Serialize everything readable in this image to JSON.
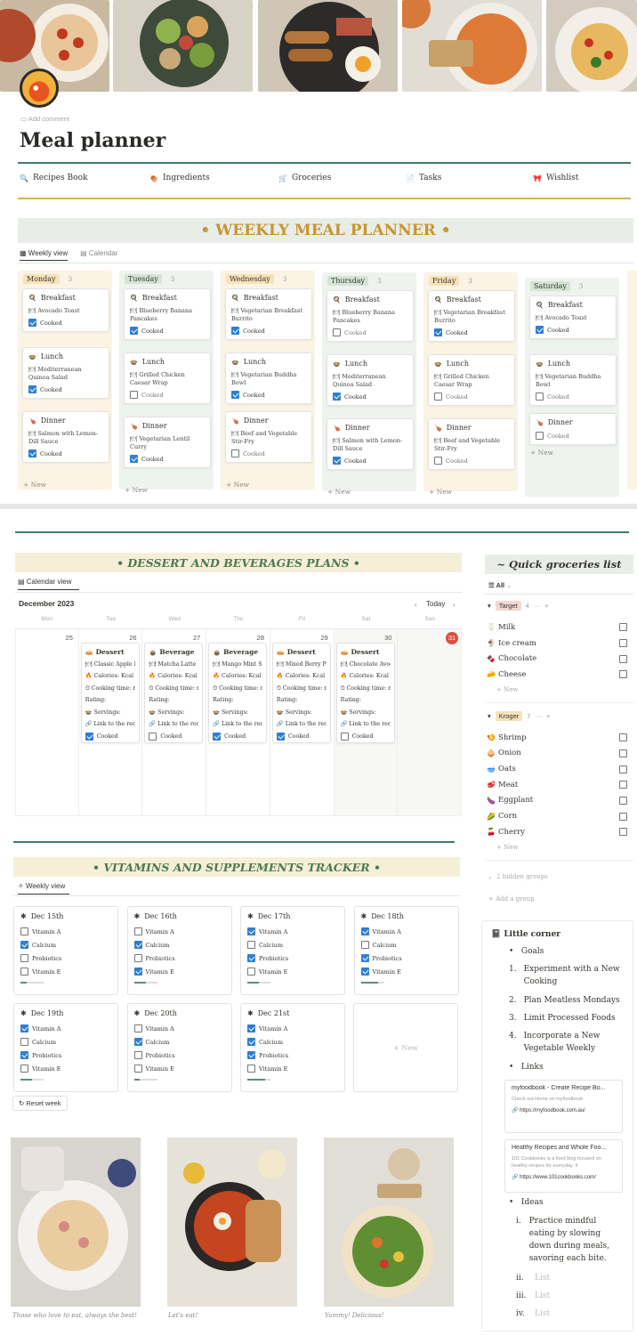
{
  "page": {
    "add_comment": "Add comment",
    "title": "Meal planner"
  },
  "nav": [
    "Recipes Book",
    "Ingredients",
    "Groceries",
    "Tasks",
    "Wishlist"
  ],
  "weekly": {
    "header": "• WEEKLY MEAL PLANNER •",
    "views": [
      "Weekly view",
      "Calendar"
    ],
    "new_label": "+ New",
    "cooked_label": "Cooked",
    "columns": [
      {
        "day": "Monday",
        "count": "3",
        "color": "#fbf3e4",
        "tag": "#f7e2b9",
        "meals": [
          {
            "meal": "Breakfast",
            "dish": "Avocado Toast",
            "cooked": true
          },
          {
            "meal": "Lunch",
            "dish": "Mediterranean Quinoa Salad",
            "cooked": true
          },
          {
            "meal": "Dinner",
            "dish": "Salmon with Lemon-Dill Sauce",
            "cooked": true
          }
        ]
      },
      {
        "day": "Tuesday",
        "count": "3",
        "color": "#eef3ee",
        "tag": "#d3e6d5",
        "meals": [
          {
            "meal": "Breakfast",
            "dish": "Blueberry Banana Pancakes",
            "cooked": true
          },
          {
            "meal": "Lunch",
            "dish": "Grilled Chicken Caesar Wrap",
            "cooked": false
          },
          {
            "meal": "Dinner",
            "dish": "Vegetarian Lentil Curry",
            "cooked": true
          }
        ]
      },
      {
        "day": "Wednesday",
        "count": "3",
        "color": "#fbf3e4",
        "tag": "#f7e2b9",
        "meals": [
          {
            "meal": "Breakfast",
            "dish": "Vegetarian Breakfast Burrito",
            "cooked": true
          },
          {
            "meal": "Lunch",
            "dish": "Vegetarian Buddha Bowl",
            "cooked": true
          },
          {
            "meal": "Dinner",
            "dish": "Beef and Vegetable Stir-Fry",
            "cooked": false
          }
        ]
      },
      {
        "day": "Thursday",
        "count": "3",
        "color": "#eef3ee",
        "tag": "#d3e6d5",
        "meals": [
          {
            "meal": "Breakfast",
            "dish": "Blueberry Banana Pancakes",
            "cooked": false
          },
          {
            "meal": "Lunch",
            "dish": "Mediterranean Quinoa Salad",
            "cooked": true
          },
          {
            "meal": "Dinner",
            "dish": "Salmon with Lemon-Dill Sauce",
            "cooked": true
          }
        ]
      },
      {
        "day": "Friday",
        "count": "3",
        "color": "#fbf3e4",
        "tag": "#f7e2b9",
        "meals": [
          {
            "meal": "Breakfast",
            "dish": "Vegetarian Breakfast Burrito",
            "cooked": true
          },
          {
            "meal": "Lunch",
            "dish": "Grilled Chicken Caesar Wrap",
            "cooked": false
          },
          {
            "meal": "Dinner",
            "dish": "Beef and Vegetable Stir-Fry",
            "cooked": false
          }
        ]
      },
      {
        "day": "Saturday",
        "count": "3",
        "color": "#eef3ee",
        "tag": "#d3e6d5",
        "meals": [
          {
            "meal": "Breakfast",
            "dish": "Avocado Toast",
            "cooked": true
          },
          {
            "meal": "Lunch",
            "dish": "Vegetarian Buddha Bowl",
            "cooked": false
          },
          {
            "meal": "Dinner",
            "dish": "",
            "cooked": false
          }
        ]
      }
    ]
  },
  "dessert": {
    "header": "• DESSERT AND BEVERAGES PLANS •",
    "view": "Calendar view",
    "month": "December 2023",
    "today": "Today",
    "weekdays": [
      "Mon",
      "Tue",
      "Wed",
      "Thu",
      "Fri",
      "Sat",
      "Sun"
    ],
    "dates": [
      "25",
      "26",
      "27",
      "28",
      "29",
      "30",
      "31"
    ],
    "cards": [
      {
        "type": "Dessert",
        "name": "Classic Apple Pie",
        "cooked": true
      },
      {
        "type": "Beverage",
        "name": "Matcha Latte",
        "cooked": false
      },
      {
        "type": "Beverage",
        "name": "Mango Mint Smo",
        "cooked": true
      },
      {
        "type": "Dessert",
        "name": "Mixed Berry Parf",
        "cooked": true
      },
      {
        "type": "Dessert",
        "name": "Chocolate Avoca",
        "cooked": false
      }
    ],
    "fields": {
      "calories": "Calories: Kcal",
      "cooking": "Cooking time: m",
      "rating": "Rating:",
      "servings": "Servings:",
      "link": "Link to the recip",
      "cooked": "Cooked"
    }
  },
  "vitamins": {
    "header": "• VITAMINS AND SUPPLEMENTS TRACKER •",
    "view": "Weekly view",
    "items": [
      "Vitamin A",
      "Calcium",
      "Probiotics",
      "Vitamin E"
    ],
    "days": [
      {
        "date": "Dec 15th",
        "checks": [
          false,
          true,
          false,
          false
        ],
        "progress": 0.25
      },
      {
        "date": "Dec 16th",
        "checks": [
          false,
          true,
          false,
          true
        ],
        "progress": 0.5
      },
      {
        "date": "Dec 17th",
        "checks": [
          true,
          false,
          true,
          false
        ],
        "progress": 0.5
      },
      {
        "date": "Dec 18th",
        "checks": [
          true,
          false,
          true,
          true
        ],
        "progress": 0.75
      },
      {
        "date": "Dec 19th",
        "checks": [
          true,
          false,
          true,
          false
        ],
        "progress": 0.5
      },
      {
        "date": "Dec 20th",
        "checks": [
          false,
          true,
          false,
          false
        ],
        "progress": 0.25
      },
      {
        "date": "Dec 21st",
        "checks": [
          true,
          true,
          true,
          false
        ],
        "progress": 0.75
      }
    ],
    "new_label": "+ New",
    "reset": "Reset week"
  },
  "groceries": {
    "header": "~ Quick groceries list",
    "filter": "All",
    "groups": [
      {
        "name": "Target",
        "count": "4",
        "items": [
          {
            "n": "Milk",
            "e": "🥛"
          },
          {
            "n": "Ice cream",
            "e": "🍨"
          },
          {
            "n": "Chocolate",
            "e": "🍫"
          },
          {
            "n": "Cheese",
            "e": "🧀"
          }
        ]
      },
      {
        "name": "Kroger",
        "count": "7",
        "items": [
          {
            "n": "Shrimp",
            "e": "🍤"
          },
          {
            "n": "Onion",
            "e": "🧅"
          },
          {
            "n": "Oats",
            "e": "🥣"
          },
          {
            "n": "Meat",
            "e": "🥩"
          },
          {
            "n": "Eggplant",
            "e": "🍆"
          },
          {
            "n": "Corn",
            "e": "🌽"
          },
          {
            "n": "Cherry",
            "e": "🍒"
          }
        ]
      }
    ],
    "new_label": "+ New",
    "hidden": "2 hidden groups",
    "add_group": "+ Add a group"
  },
  "corner": {
    "title": "Little corner",
    "goals": "Goals",
    "numbered": [
      "Experiment with a New Cooking",
      "Plan Meatless Mondays",
      "Limit Processed Foods",
      "Incorporate a New Vegetable Weekly"
    ],
    "links": "Links",
    "link_cards": [
      {
        "title": "myfoodbook - Create Recipe Bo...",
        "desc": "Check out Home on myfoodbook",
        "url": "https://myfoodbook.com.au/"
      },
      {
        "title": "Healthy Recipes and Whole Foo...",
        "desc": "101 Cookbooks is a food blog focused on healthy recipes for everyday. It",
        "url": "https://www.101cookbooks.com/"
      }
    ],
    "ideas": "Ideas",
    "idea_items": [
      {
        "num": "i.",
        "text": "Practice mindful eating by slowing down during meals, savoring each bite."
      },
      {
        "num": "ii.",
        "text": "List"
      },
      {
        "num": "iii.",
        "text": "List"
      },
      {
        "num": "iv.",
        "text": "List"
      }
    ]
  },
  "captions": [
    "Those who love to eat, always the best!",
    "Let's eat!",
    "Yummy! Delicious!"
  ]
}
